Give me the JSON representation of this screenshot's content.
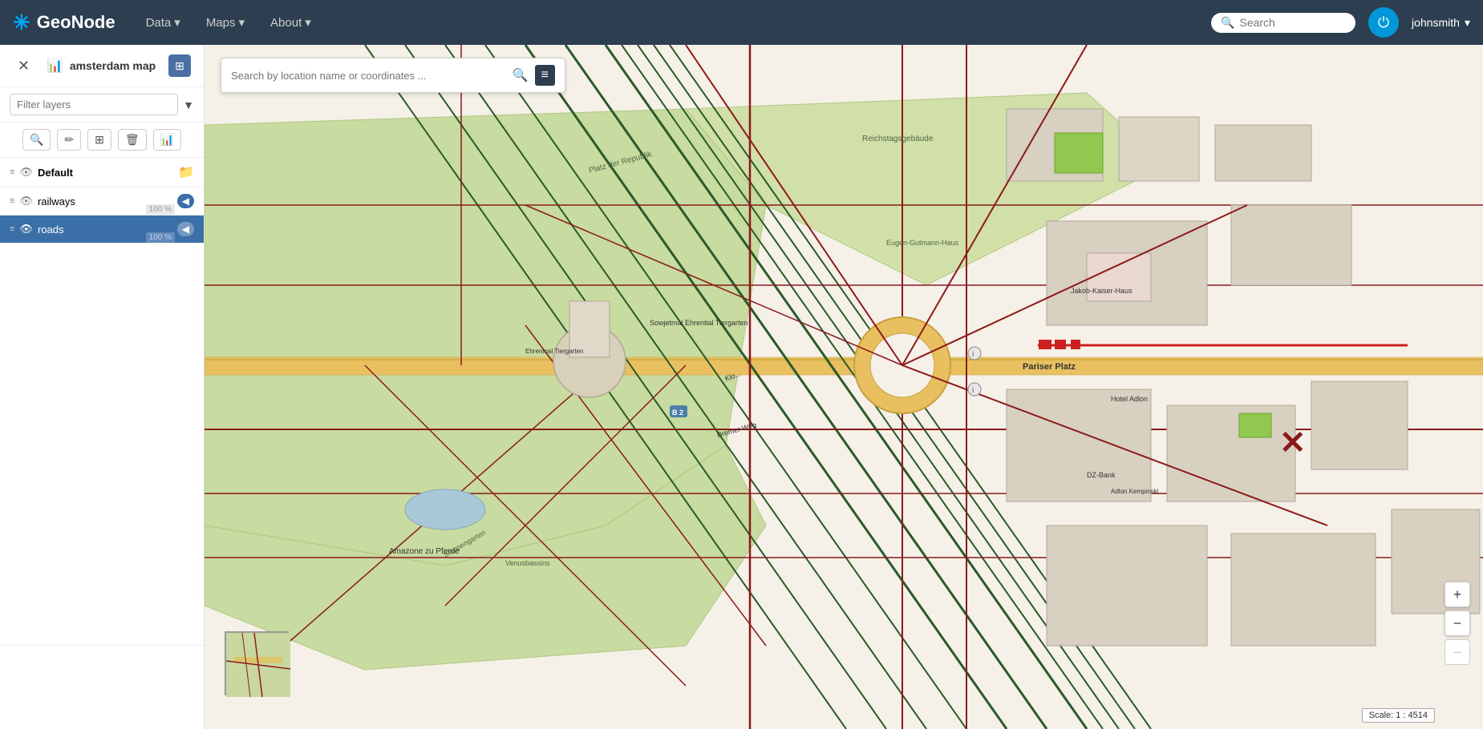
{
  "topnav": {
    "logo": "GeoNode",
    "logo_star": "✳",
    "menu_items": [
      {
        "label": "Data",
        "has_dropdown": true
      },
      {
        "label": "Maps",
        "has_dropdown": true
      },
      {
        "label": "About",
        "has_dropdown": true
      }
    ],
    "search_placeholder": "Search",
    "user_name": "johnsmith"
  },
  "loc_search": {
    "placeholder": "Search by location name or coordinates ..."
  },
  "left_panel": {
    "map_title": "amsterdam map",
    "filter_placeholder": "Filter layers",
    "toolbar": {
      "zoom_btn": "🔍",
      "pencil_btn": "✏",
      "table_btn": "⊞",
      "trash_btn": "🗑",
      "chart_btn": "📊"
    },
    "layers": [
      {
        "id": "default",
        "name": "Default",
        "type": "group",
        "visible": true,
        "active": false
      },
      {
        "id": "railways",
        "name": "railways",
        "type": "layer",
        "visible": true,
        "active": false,
        "opacity": "100 %"
      },
      {
        "id": "roads",
        "name": "roads",
        "type": "layer",
        "visible": true,
        "active": true,
        "opacity": "100 %"
      }
    ]
  },
  "map": {
    "scale_label": "Scale: 1 : 4514"
  },
  "roads_badge": "roads 100"
}
